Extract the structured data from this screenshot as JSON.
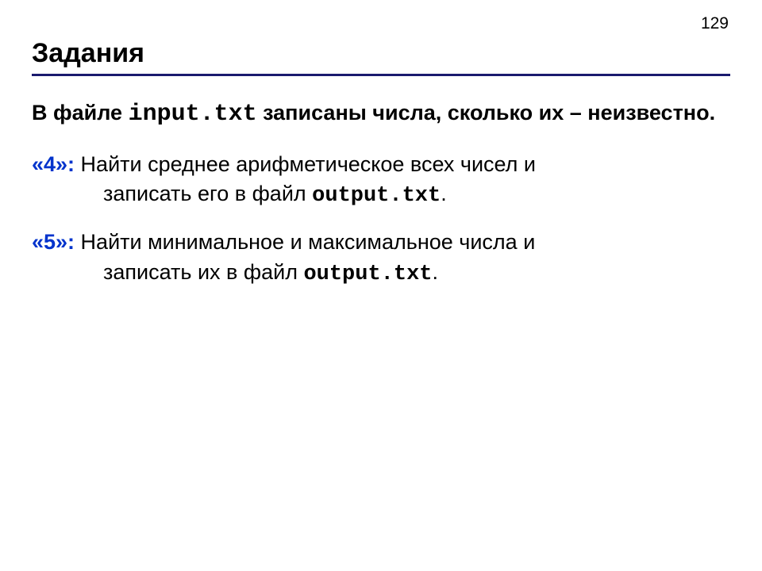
{
  "page_number": "129",
  "title": "Задания",
  "intro": {
    "part1": "В файле ",
    "code": "input.txt",
    "part2": " записаны числа, сколько их – неизвестно."
  },
  "tasks": [
    {
      "label": "«4»:",
      "line1": "  Найти среднее арифметическое всех чисел и",
      "line2_prefix": "записать его в файл ",
      "line2_code": "output.txt",
      "line2_suffix": "."
    },
    {
      "label": "«5»:",
      "line1": "  Найти минимальное и максимальное числа и",
      "line2_prefix": "записать их в файл ",
      "line2_code": "output.txt",
      "line2_suffix": "."
    }
  ]
}
